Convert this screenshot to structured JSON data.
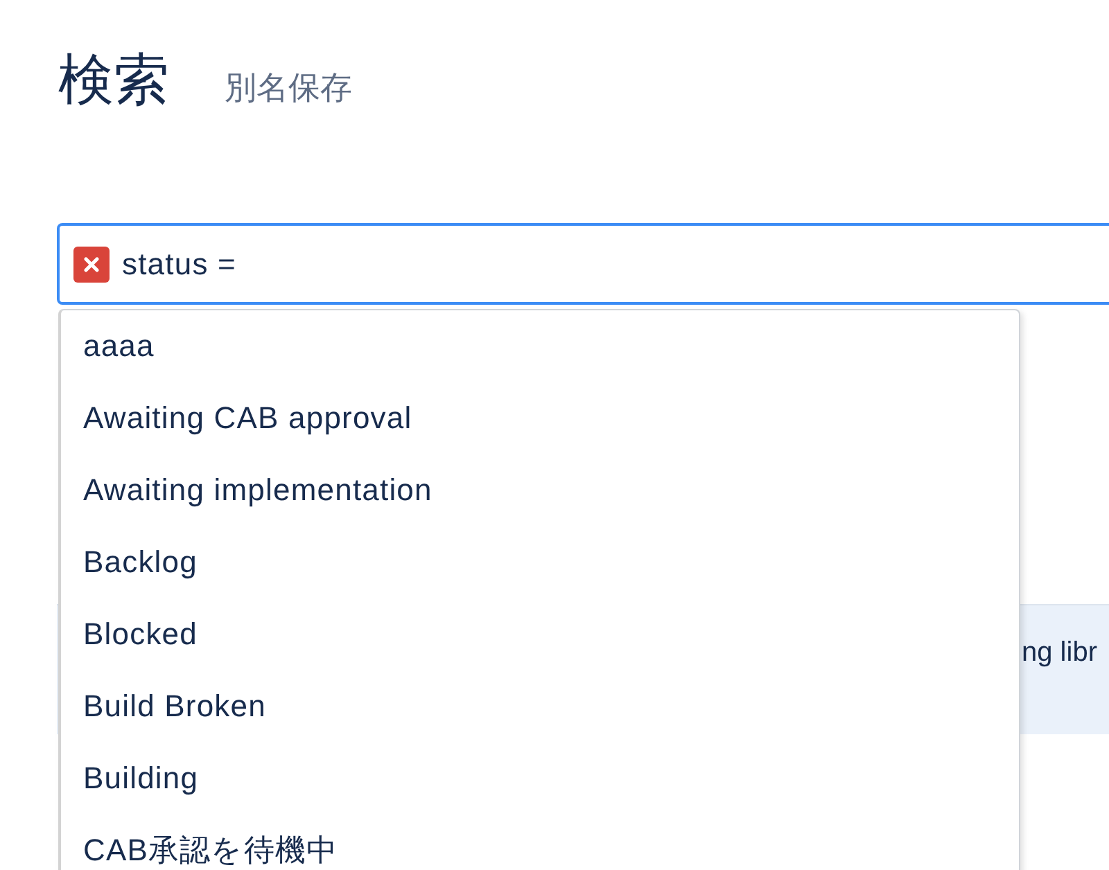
{
  "header": {
    "title": "検索",
    "save_as_link": "別名保存"
  },
  "search": {
    "value": "status =",
    "clearable": true
  },
  "notice": {
    "text": "ng libr"
  },
  "suggestions": [
    {
      "label": "aaaa",
      "selected": false
    },
    {
      "label": "Awaiting CAB approval",
      "selected": false
    },
    {
      "label": "Awaiting implementation",
      "selected": false
    },
    {
      "label": "Backlog",
      "selected": false
    },
    {
      "label": "Blocked",
      "selected": false
    },
    {
      "label": "Build Broken",
      "selected": false
    },
    {
      "label": "Building",
      "selected": false
    },
    {
      "label": "CAB承認を待機中",
      "selected": false
    }
  ]
}
